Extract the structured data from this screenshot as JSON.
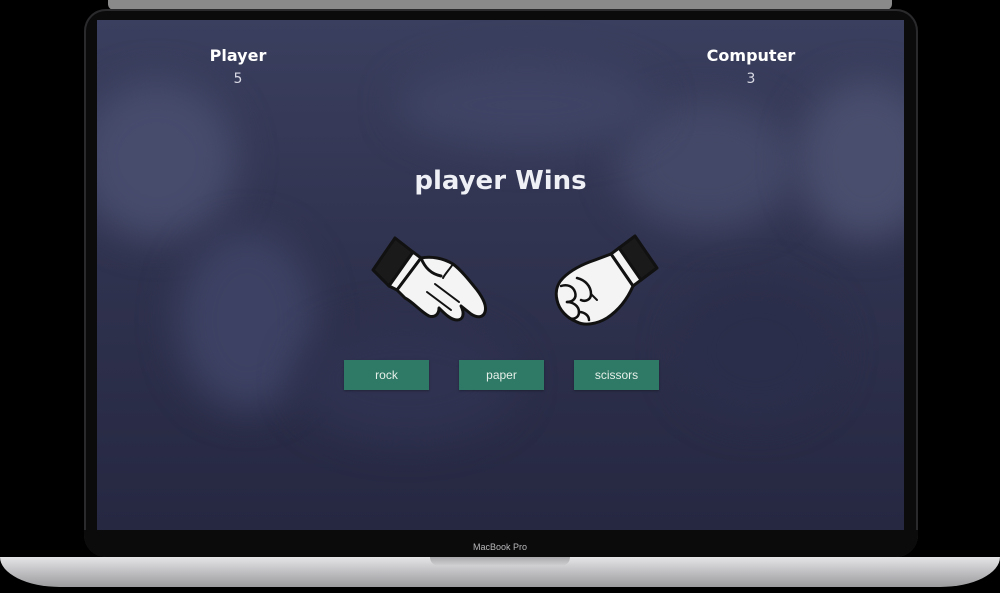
{
  "scoreboard": {
    "player_label": "Player",
    "player_score": "5",
    "computer_label": "Computer",
    "computer_score": "3"
  },
  "result_text": "player Wins",
  "hands": {
    "player": "paper-hand-icon",
    "computer": "rock-fist-icon"
  },
  "buttons": {
    "rock": "rock",
    "paper": "paper",
    "scissors": "scissors"
  },
  "device": {
    "label": "MacBook Pro"
  },
  "colors": {
    "button": "#2f7a66",
    "background": "#30334f"
  }
}
